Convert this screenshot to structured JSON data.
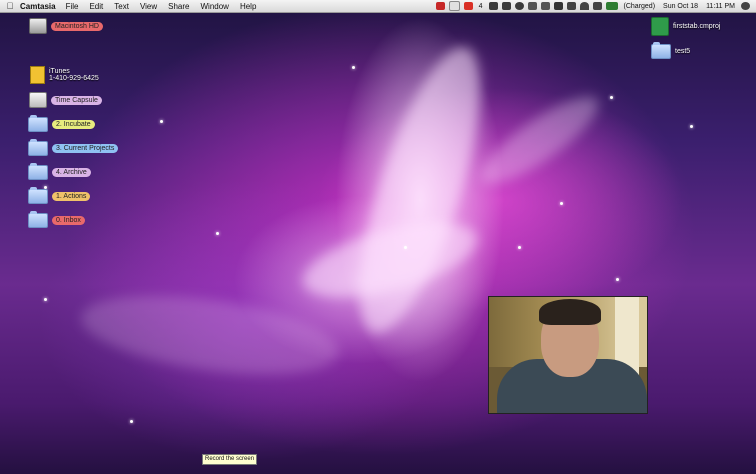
{
  "menubar": {
    "app_name": "Camtasia",
    "menus": [
      "File",
      "Edit",
      "Text",
      "View",
      "Share",
      "Window",
      "Help"
    ],
    "gmail_count": "4",
    "battery_status": "(Charged)",
    "date": "Sun Oct 18",
    "time": "11:11 PM"
  },
  "desktop_left": [
    {
      "label": "Macintosh HD",
      "label_color": "#e8696b",
      "icon": "hard-drive-icon"
    },
    {
      "label": "iTunes",
      "sub": "1-410-929-6425",
      "icon": "document-icon"
    },
    {
      "label": "Time Capsule",
      "label_color": "#d9b4e6",
      "icon": "time-capsule-icon"
    },
    {
      "label": "2. Incubate",
      "label_color": "#e7ec7e",
      "icon": "folder-icon"
    },
    {
      "label": "3. Current Projects",
      "label_color": "#8fc1f2",
      "icon": "folder-icon"
    },
    {
      "label": "4. Archive",
      "label_color": "#d9b4e6",
      "icon": "folder-icon"
    },
    {
      "label": "1. Actions",
      "label_color": "#f0c26a",
      "icon": "folder-icon"
    },
    {
      "label": "0. Inbox",
      "label_color": "#e8696b",
      "icon": "folder-icon"
    }
  ],
  "desktop_right": [
    {
      "label": "firststab.cmproj",
      "icon": "camtasia-project-icon"
    },
    {
      "label": "test5",
      "icon": "folder-icon"
    }
  ],
  "tooltip": "Record the screen"
}
